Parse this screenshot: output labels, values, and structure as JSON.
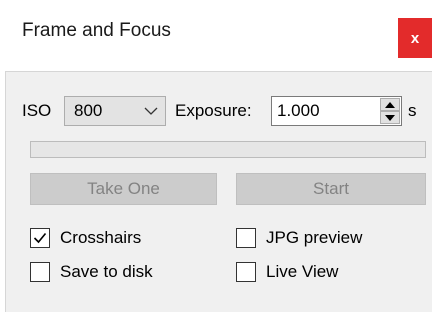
{
  "window": {
    "title": "Frame and Focus",
    "close_label": "x"
  },
  "iso": {
    "label": "ISO",
    "value": "800"
  },
  "exposure": {
    "label": "Exposure:",
    "value": "1.000",
    "unit": "s"
  },
  "progress": {
    "value_percent": 0
  },
  "buttons": {
    "take_one": "Take One",
    "start": "Start"
  },
  "options": {
    "crosshairs": {
      "label": "Crosshairs",
      "checked": true
    },
    "jpg_preview": {
      "label": "JPG preview",
      "checked": false
    },
    "save_to_disk": {
      "label": "Save to disk",
      "checked": false
    },
    "live_view": {
      "label": "Live View",
      "checked": false
    }
  },
  "colors": {
    "close_button": "#e32b2b",
    "disabled_button": "#cccccc",
    "panel_background": "#f0f0f0"
  }
}
